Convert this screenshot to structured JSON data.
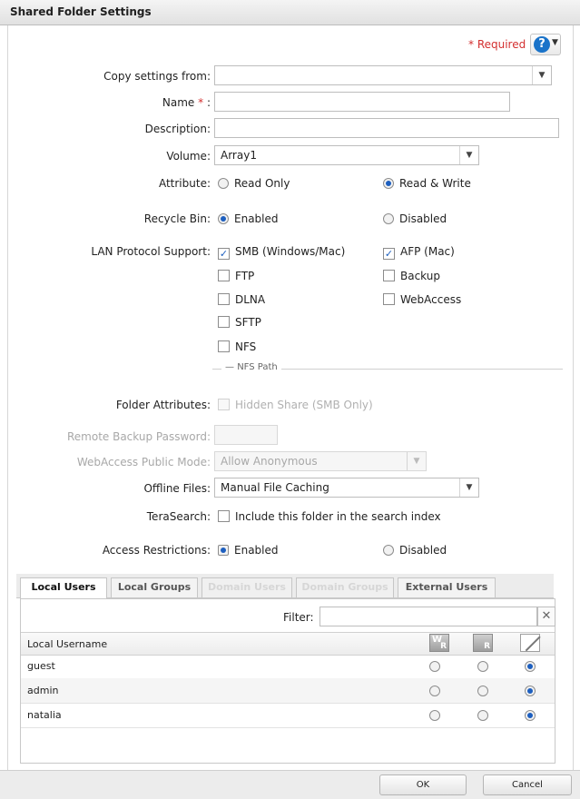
{
  "window": {
    "title": "Shared Folder Settings"
  },
  "header": {
    "required_label": "* Required",
    "help_icon": "question-circle-icon"
  },
  "form": {
    "copy_from_label": "Copy settings from:",
    "copy_from_value": "",
    "name_label": "Name",
    "name_required": "*",
    "name_suffix": ":",
    "name_value": "",
    "description_label": "Description:",
    "description_value": "",
    "volume_label": "Volume:",
    "volume_value": "Array1",
    "attribute_label": "Attribute:",
    "attribute_read_only": "Read Only",
    "attribute_read_write": "Read & Write",
    "attribute_selected": "Read & Write",
    "recycle_label": "Recycle Bin:",
    "recycle_enabled": "Enabled",
    "recycle_disabled": "Disabled",
    "recycle_selected": "Enabled",
    "lan_label": "LAN Protocol Support:",
    "protocols": {
      "smb": {
        "label": "SMB (Windows/Mac)",
        "checked": true
      },
      "afp": {
        "label": "AFP (Mac)",
        "checked": true
      },
      "ftp": {
        "label": "FTP",
        "checked": false
      },
      "backup": {
        "label": "Backup",
        "checked": false
      },
      "dlna": {
        "label": "DLNA",
        "checked": false
      },
      "webaccess": {
        "label": "WebAccess",
        "checked": false
      },
      "sftp": {
        "label": "SFTP",
        "checked": false
      },
      "nfs": {
        "label": "NFS",
        "checked": false
      }
    },
    "nfs_path_label": "NFS Path",
    "folder_attr_label": "Folder Attributes:",
    "hidden_share": "Hidden Share (SMB Only)",
    "remote_backup_label": "Remote Backup Password:",
    "remote_backup_value": "",
    "webaccess_mode_label": "WebAccess Public Mode:",
    "webaccess_mode_value": "Allow Anonymous",
    "offline_label": "Offline Files:",
    "offline_value": "Manual File Caching",
    "terasearch_label": "TeraSearch:",
    "terasearch_option": "Include this folder in the search index",
    "terasearch_checked": false,
    "access_label": "Access Restrictions:",
    "access_enabled": "Enabled",
    "access_disabled": "Disabled",
    "access_selected": "Enabled"
  },
  "tabs": [
    {
      "label": "Local Users",
      "state": "active"
    },
    {
      "label": "Local Groups",
      "state": "normal"
    },
    {
      "label": "Domain Users",
      "state": "disabled"
    },
    {
      "label": "Domain Groups",
      "state": "disabled"
    },
    {
      "label": "External Users",
      "state": "normal"
    }
  ],
  "grid": {
    "filter_label": "Filter:",
    "filter_value": "",
    "clear_icon": "close-icon",
    "column_header": "Local Username",
    "perm_headers": [
      {
        "top": "W",
        "bottom": "R",
        "meaning": "read-write"
      },
      {
        "top": "",
        "bottom": "R",
        "meaning": "read-only"
      },
      {
        "top": "",
        "bottom": "",
        "meaning": "no-access"
      }
    ],
    "rows": [
      {
        "name": "guest",
        "permission": "no-access"
      },
      {
        "name": "admin",
        "permission": "no-access"
      },
      {
        "name": "natalia",
        "permission": "no-access"
      }
    ]
  },
  "footer": {
    "ok_label": "OK",
    "cancel_label": "Cancel"
  }
}
